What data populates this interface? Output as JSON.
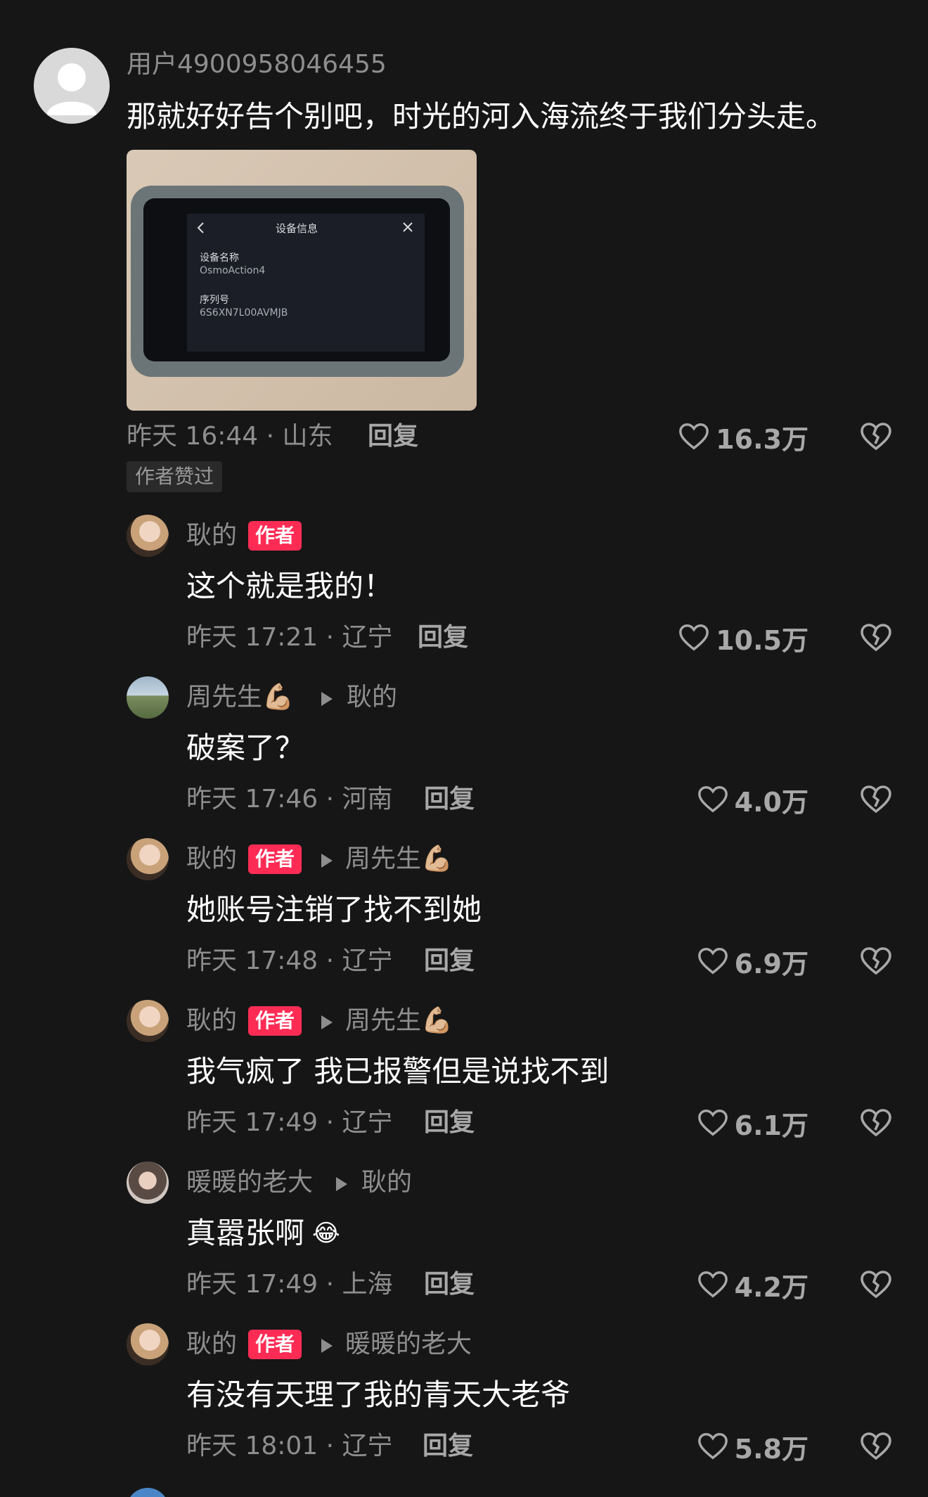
{
  "colors": {
    "background": "#161616",
    "author_badge": "#fe2c55",
    "text_secondary": "#8e8e8e"
  },
  "main_comment": {
    "username": "用户4900958046455",
    "text": "那就好好告个别吧，时光的河入海流终于我们分头走。",
    "time_location": "昨天 16:44 · 山东",
    "reply_label": "回复",
    "likes": "16.3万",
    "liked_tag": "作者赞过",
    "photo": {
      "screen_title": "设备信息",
      "field1_label": "设备名称",
      "field1_value": "OsmoAction4",
      "field2_label": "序列号",
      "field2_value": "6S6XN7L00AVMJB"
    }
  },
  "replies": [
    {
      "username": "耿的",
      "is_author": true,
      "author_label": "作者",
      "reply_to": "",
      "text": "这个就是我的！",
      "time_location": "昨天 17:21 · 辽宁",
      "reply_label": "回复",
      "likes": "10.5万",
      "avatar": "woman-avatar"
    },
    {
      "username": "周先生💪🏼",
      "is_author": false,
      "reply_to": "耿的",
      "text": "破案了？",
      "time_location": "昨天 17:46 · 河南",
      "reply_label": "回复",
      "likes": "4.0万",
      "avatar": "landscape-avatar"
    },
    {
      "username": "耿的",
      "is_author": true,
      "author_label": "作者",
      "reply_to": "周先生💪🏼",
      "text": "她账号注销了找不到她",
      "time_location": "昨天 17:48 · 辽宁",
      "reply_label": "回复",
      "likes": "6.9万",
      "avatar": "woman-avatar"
    },
    {
      "username": "耿的",
      "is_author": true,
      "author_label": "作者",
      "reply_to": "周先生💪🏼",
      "text": "我气疯了 我已报警但是说找不到",
      "time_location": "昨天 17:49 · 辽宁",
      "reply_label": "回复",
      "likes": "6.1万",
      "avatar": "woman-avatar"
    },
    {
      "username": "暖暖的老大",
      "is_author": false,
      "reply_to": "耿的",
      "text": "真嚣张啊",
      "text_emoji": "😂",
      "time_location": "昨天 17:49 · 上海",
      "reply_label": "回复",
      "likes": "4.2万",
      "avatar": "girl-avatar"
    },
    {
      "username": "耿的",
      "is_author": true,
      "author_label": "作者",
      "reply_to": "暖暖的老大",
      "text": "有没有天理了我的青天大老爷",
      "time_location": "昨天 18:01 · 辽宁",
      "reply_label": "回复",
      "likes": "5.8万",
      "avatar": "woman-avatar"
    }
  ]
}
